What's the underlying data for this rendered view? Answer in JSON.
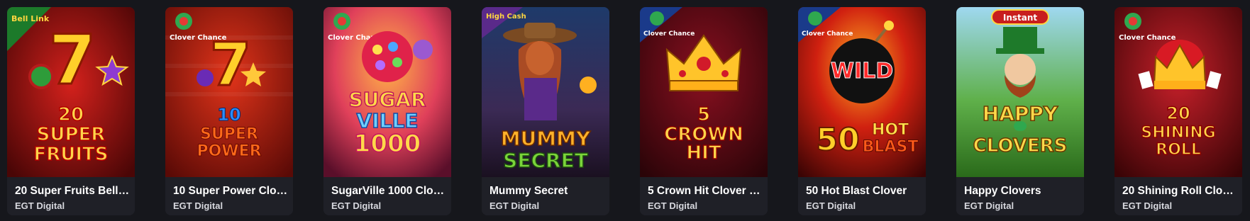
{
  "games": [
    {
      "title": "20 Super Fruits Bell ...",
      "provider": "EGT Digital",
      "badge": "Bell Link",
      "art_lines": [
        "20",
        "SUPER",
        "FRUITS"
      ],
      "accent": "#c8102e"
    },
    {
      "title": "10 Super Power Clov...",
      "provider": "EGT Digital",
      "badge": "Clover Chance",
      "art_lines": [
        "10",
        "SUPER",
        "POWER"
      ],
      "accent": "#b9151b"
    },
    {
      "title": "SugarVille 1000 Clov...",
      "provider": "EGT Digital",
      "badge": "Clover Chance",
      "art_lines": [
        "SUGAR",
        "VILLE",
        "1000"
      ],
      "accent": "#e23a64"
    },
    {
      "title": "Mummy Secret",
      "provider": "EGT Digital",
      "badge": "High Cash",
      "art_lines": [
        "MUMMY",
        "SECRET"
      ],
      "accent": "#2a3b62"
    },
    {
      "title": "5 Crown Hit Clover C...",
      "provider": "EGT Digital",
      "badge": "Clover Chance",
      "art_lines": [
        "5",
        "CROWN",
        "HIT"
      ],
      "accent": "#6e0b16"
    },
    {
      "title": "50 Hot Blast Clover",
      "provider": "EGT Digital",
      "badge": "Clover Chance",
      "art_lines": [
        "WILD",
        "50",
        "HOT",
        "BLAST"
      ],
      "accent": "#c41d13"
    },
    {
      "title": "Happy Clovers",
      "provider": "EGT Digital",
      "badge": "Instant",
      "art_lines": [
        "HAPPY",
        "CLOVERS"
      ],
      "accent": "#3f8f2a"
    },
    {
      "title": "20 Shining Roll Clove...",
      "provider": "EGT Digital",
      "badge": "Clover Chance",
      "art_lines": [
        "20",
        "SHINING",
        "ROLL"
      ],
      "accent": "#9b1018"
    }
  ]
}
